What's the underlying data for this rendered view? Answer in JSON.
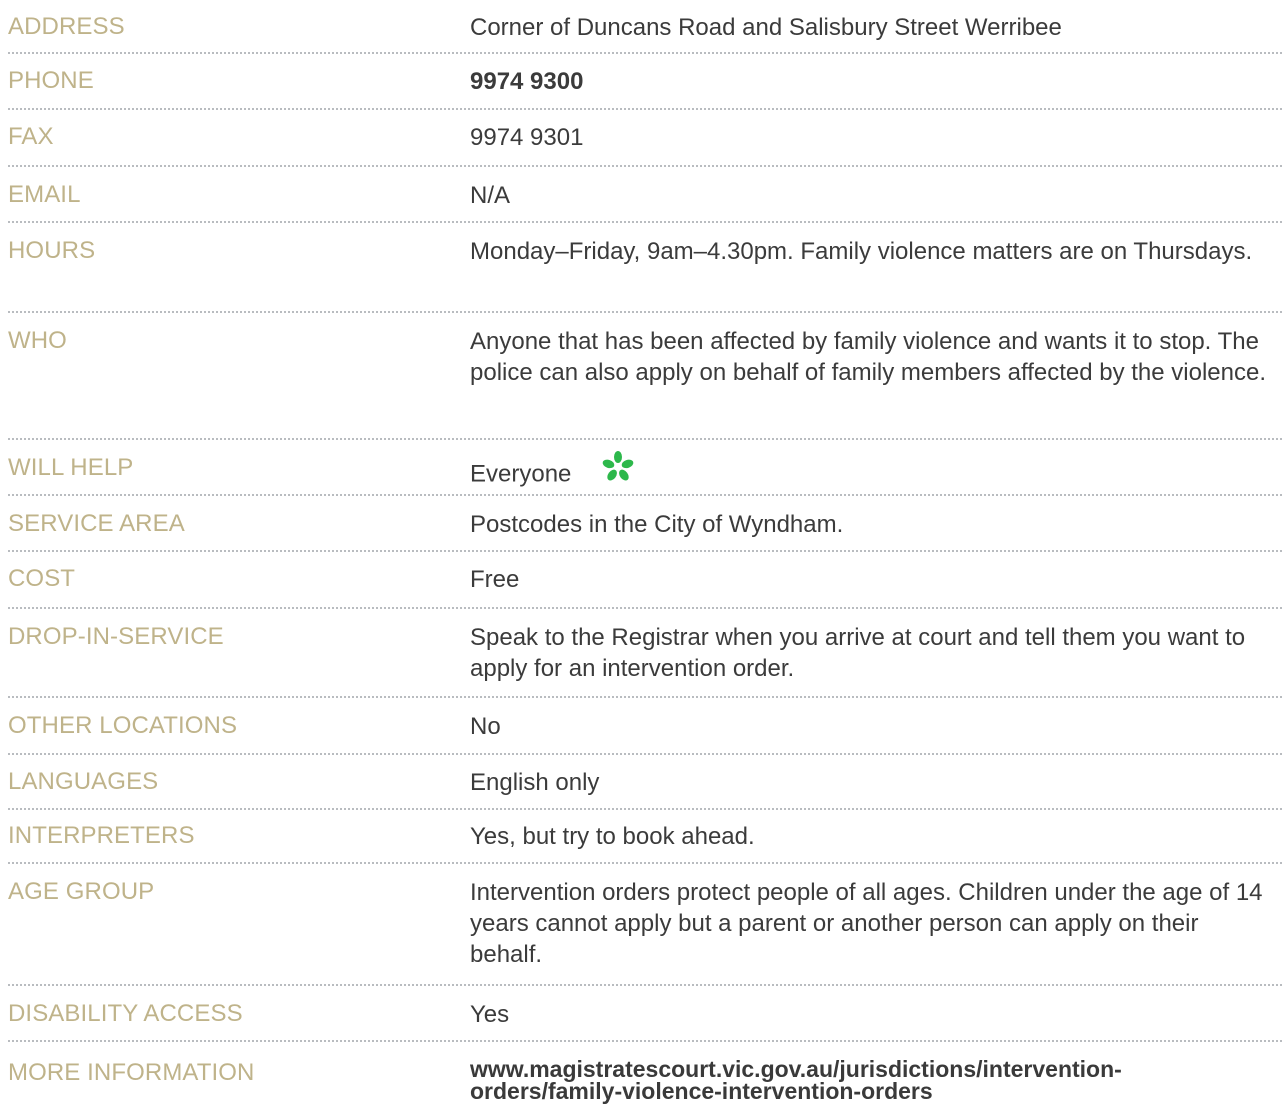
{
  "rows": [
    {
      "label": "ADDRESS",
      "value": "Corner of Duncans Road and Salisbury Street Werribee"
    },
    {
      "label": "PHONE",
      "value": "9974 9300"
    },
    {
      "label": "FAX",
      "value": "9974 9301"
    },
    {
      "label": "EMAIL",
      "value": "N/A"
    },
    {
      "label": "HOURS",
      "value": "Monday–Friday, 9am–4.30pm. Family violence matters are on Thursdays."
    },
    {
      "label": "WHO",
      "value": "Anyone that has been affected by family violence and wants it to stop. The police can also apply on behalf of family members affected by the violence."
    },
    {
      "label": "WILL HELP",
      "value": "Everyone",
      "icon": "everyone-flower-icon",
      "icon_color": "#2db84b"
    },
    {
      "label": "SERVICE AREA",
      "value": "Postcodes in the City of Wyndham."
    },
    {
      "label": "COST",
      "value": "Free"
    },
    {
      "label": "DROP-IN-SERVICE",
      "value": "Speak to the Registrar when you arrive at court and tell them you want to apply for an intervention order."
    },
    {
      "label": "OTHER LOCATIONS",
      "value": "No"
    },
    {
      "label": "LANGUAGES",
      "value": "English only"
    },
    {
      "label": "INTERPRETERS",
      "value": "Yes, but try to book ahead."
    },
    {
      "label": "AGE GROUP",
      "value": "Intervention orders protect people of all ages. Children under the age of 14 years cannot apply but a parent or another person can apply on their behalf."
    },
    {
      "label": "DISABILITY ACCESS",
      "value": "Yes"
    },
    {
      "label": "MORE INFORMATION",
      "value": "www.magistratescourt.vic.gov.au/jurisdictions/intervention-orders/family-violence-intervention-orders"
    }
  ],
  "colors": {
    "label": "#bfb38a",
    "value": "#3b3b3b",
    "divider": "#b9bcc0"
  }
}
